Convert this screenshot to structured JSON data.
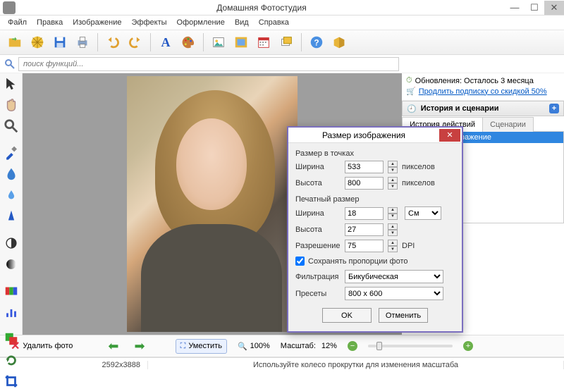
{
  "titlebar": {
    "title": "Домашняя Фотостудия"
  },
  "menu": [
    "Файл",
    "Правка",
    "Изображение",
    "Эффекты",
    "Оформление",
    "Вид",
    "Справка"
  ],
  "toolbar": {
    "icons": [
      "folder-open",
      "cog-yellow",
      "save",
      "print",
      "separator",
      "undo",
      "redo",
      "separator",
      "text-A",
      "palette",
      "separator",
      "image",
      "image-frame",
      "calendar",
      "slides",
      "separator",
      "help",
      "box"
    ]
  },
  "search": {
    "placeholder": "поиск функций..."
  },
  "left_tools": [
    "cursor",
    "pan-hand",
    "zoom",
    "sep",
    "eyedropper",
    "drop",
    "water-drop",
    "drop2",
    "sep",
    "halftone",
    "gradient",
    "sep",
    "crop-color",
    "levels",
    "sep",
    "red-plus",
    "rotate",
    "crop"
  ],
  "right": {
    "update_line": "Обновления: Осталось  3 месяца",
    "extend_link": "Продлить подписку со скидкой 50%",
    "panel_title": "История и сценарии",
    "tabs": [
      "История действий",
      "Сценарии"
    ],
    "history_item": "Исходное изображение"
  },
  "dialog": {
    "title": "Размер изображения",
    "section_points": "Размер в точках",
    "width_label": "Ширина",
    "width_value": "533",
    "height_label": "Высота",
    "height_value": "800",
    "pixels_unit": "пикселов",
    "section_print": "Печатный размер",
    "pwidth_value": "18",
    "pheight_value": "27",
    "units_label": "См",
    "res_label": "Разрешение",
    "res_value": "75",
    "dpi": "DPI",
    "keep_ratio": "Сохранять пропорции фото",
    "filter_label": "Фильтрация",
    "filter_value": "Бикубическая",
    "preset_label": "Пресеты",
    "preset_value": "800 x 600",
    "ok": "OK",
    "cancel": "Отменить"
  },
  "bottombar": {
    "delete": "Удалить фото",
    "fit": "Уместить",
    "hundred": "100%",
    "scale_label": "Масштаб:",
    "scale_value": "12%"
  },
  "statusbar": {
    "dims": "2592x3888",
    "hint": "Используйте колесо прокрутки для изменения масштаба"
  }
}
